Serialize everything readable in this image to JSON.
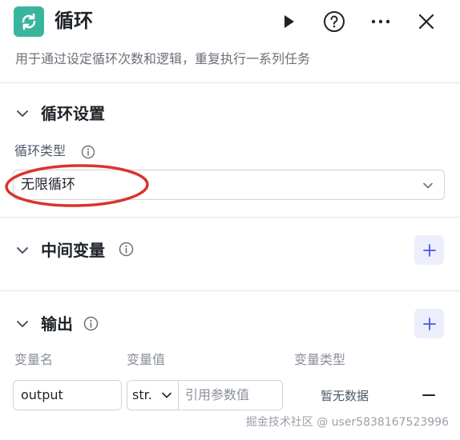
{
  "header": {
    "title": "循环",
    "app_icon": "loop-icon",
    "accent_color": "#3ab59d",
    "actions": [
      "run-icon",
      "help-icon",
      "more-icon",
      "close-icon"
    ]
  },
  "description": "用于通过设定循环次数和逻辑，重复执行一系列任务",
  "loop_settings": {
    "title": "循环设置",
    "loop_type_label": "循环类型",
    "loop_type_value": "无限循环"
  },
  "intermediate_vars": {
    "title": "中间变量"
  },
  "output": {
    "title": "输出",
    "columns": [
      "变量名",
      "变量值",
      "变量类型"
    ],
    "row": {
      "name": "output",
      "value_type": "str.",
      "value_placeholder": "引用参数值",
      "var_type": "暂无数据"
    }
  },
  "annotation_color": "#d9342b",
  "watermark": "掘金技术社区 @ user5838167523996"
}
